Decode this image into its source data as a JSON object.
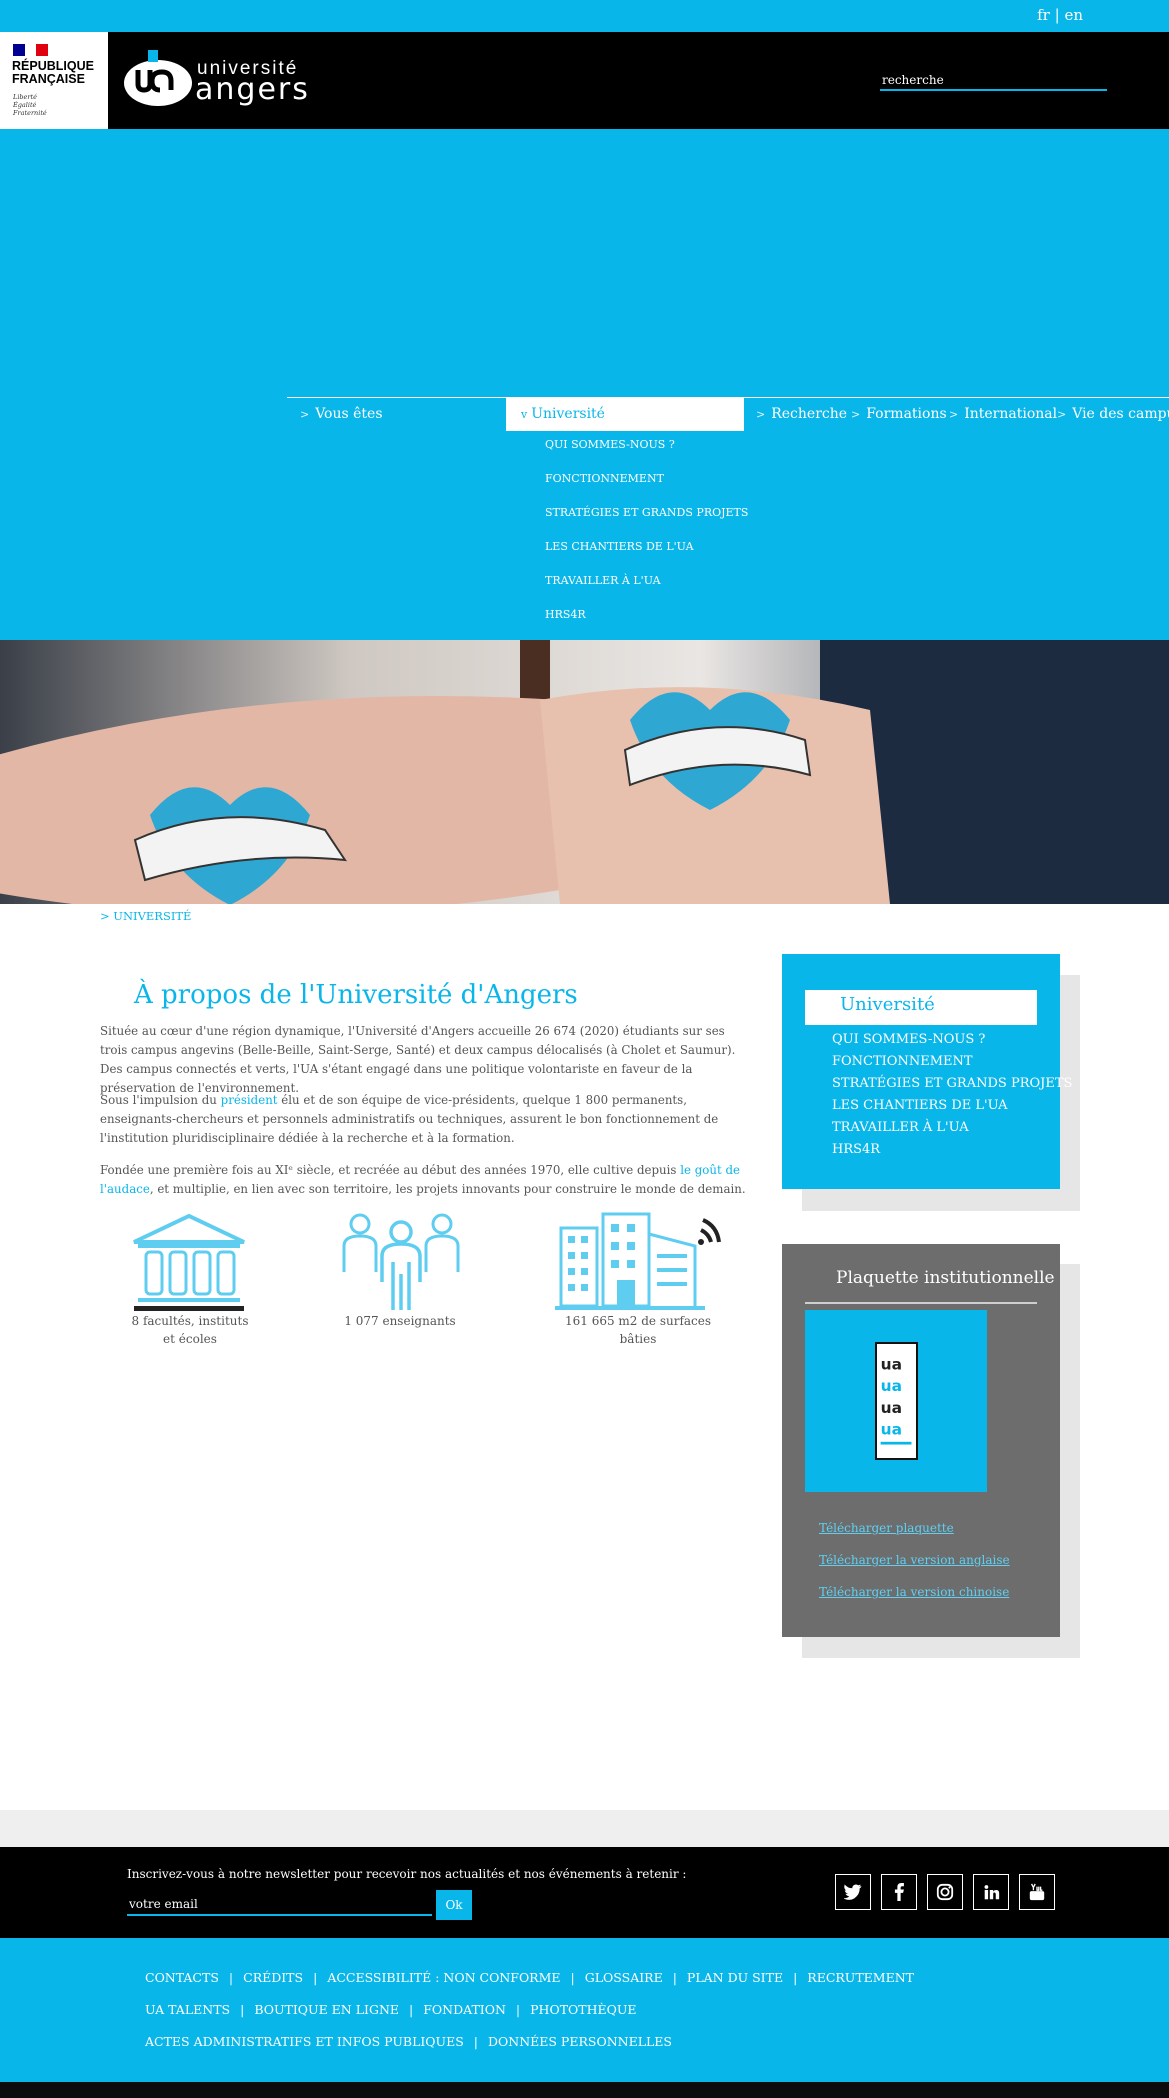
{
  "lang": {
    "fr": "fr",
    "separator": "|",
    "en": "en"
  },
  "gov": {
    "title": "RÉPUBLIQUE FRANÇAISE",
    "motto": "Liberté\nÉgalité\nFraternité"
  },
  "logo": {
    "line1": "université",
    "line2": "angers"
  },
  "search": {
    "placeholder": "recherche"
  },
  "nav": {
    "items": [
      "Vous êtes",
      "Université",
      "Recherche",
      "Formations",
      "International",
      "Vie des campus"
    ],
    "chev_closed": ">",
    "chev_open": "v",
    "submenu": [
      "QUI SOMMES-NOUS ?",
      "FONCTIONNEMENT",
      "STRATÉGIES ET GRANDS PROJETS",
      "LES CHANTIERS DE L'UA",
      "TRAVAILLER À L'UA",
      "HRS4R"
    ]
  },
  "breadcrumb": {
    "arrow": ">",
    "label": "UNIVERSITÉ"
  },
  "main": {
    "title": "À propos de l'Université d'Angers",
    "p1": "Située au cœur d'une région dynamique, l'Université d'Angers accueille 26 674 (2020) étudiants sur ses trois campus angevins (Belle-Beille, Saint-Serge, Santé) et deux campus délocalisés (à Cholet et Saumur). Des campus connectés et verts, l'UA s'étant engagé dans une politique volontariste en faveur de la préservation de l'environnement.",
    "p2_before": "Sous l'impulsion du ",
    "p2_link": "président",
    "p2_after": " élu et de son équipe de vice-présidents, quelque 1 800 permanents, enseignants-chercheurs et personnels administratifs ou techniques, assurent le bon fonctionnement de l'institution pluridisciplinaire dédiée à la recherche et à la formation.",
    "p3_before": "Fondée une première fois au XIᵉ siècle, et recréée au début des années 1970, elle cultive depuis ",
    "p3_link": "le goût de l'audace",
    "p3_after": ", et multiplie, en lien avec son territoire, les projets innovants pour construire le monde de demain.",
    "stats": [
      "8 facultés, instituts et écoles",
      "1 077 enseignants",
      "161 665 m2 de surfaces bâties"
    ]
  },
  "sidebar": {
    "title": "Université",
    "links": [
      "QUI SOMMES-NOUS ?",
      "FONCTIONNEMENT",
      "STRATÉGIES ET GRANDS PROJETS",
      "LES CHANTIERS DE L'UA",
      "TRAVAILLER À L'UA",
      "HRS4R"
    ]
  },
  "plaquette": {
    "title": "Plaquette institutionnelle",
    "links": [
      "Télécharger plaquette",
      "Télécharger la version anglaise",
      "Télécharger la version chinoise"
    ]
  },
  "newsletter": {
    "text": "Inscrivez-vous à notre newsletter pour recevoir nos actualités et nos événements à retenir :",
    "placeholder": "votre email",
    "button": "Ok"
  },
  "social": [
    "twitter-icon",
    "facebook-icon",
    "instagram-icon",
    "linkedin-icon",
    "youtube-icon"
  ],
  "footer": {
    "separator": "|",
    "row1": [
      "CONTACTS",
      "CRÉDITS",
      "ACCESSIBILITÉ : NON CONFORME",
      "GLOSSAIRE",
      "PLAN DU SITE",
      "RECRUTEMENT"
    ],
    "row2": [
      "UA TALENTS",
      "BOUTIQUE EN LIGNE",
      "FONDATION",
      "PHOTOTHÈQUE"
    ],
    "row3": [
      "ACTES ADMINISTRATIFS ET INFOS PUBLIQUES",
      "DONNÉES PERSONNELLES"
    ]
  },
  "colors": {
    "accent": "#09b6ea",
    "header": "#000000",
    "plaquette_bg": "#6d6d6d"
  }
}
